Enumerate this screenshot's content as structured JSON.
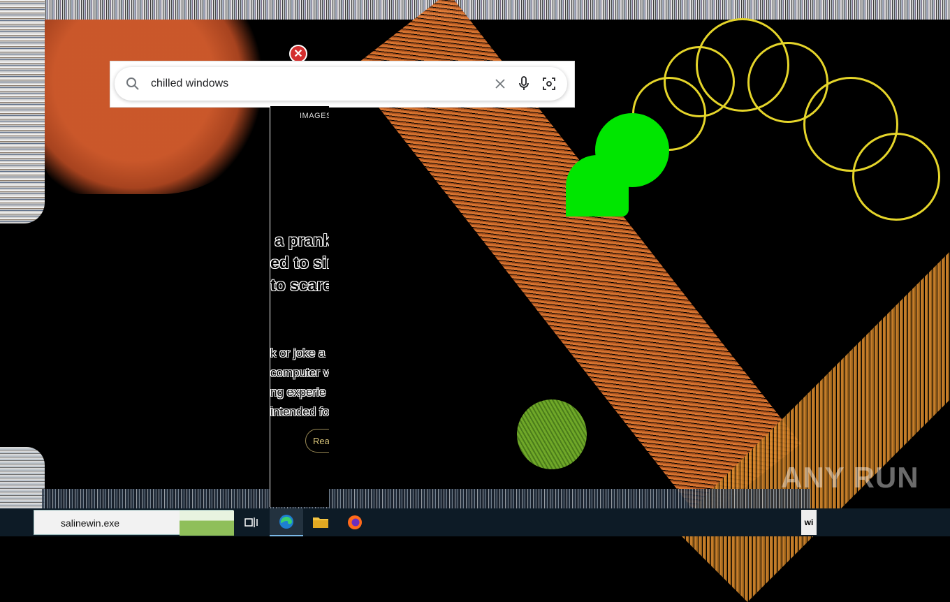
{
  "search": {
    "query": "chilled windows"
  },
  "panel": {
    "tab_label": "IMAGES",
    "headline": " a prank\ned to sim\nto scare",
    "body": "k or joke a\ncomputer v\nng experie\nintended fo",
    "read_more": "Rea"
  },
  "taskbar": {
    "search_text": "salinewin.exe",
    "tray_text": "wi",
    "apps": [
      "task-view",
      "edge",
      "file-explorer",
      "firefox"
    ]
  },
  "watermark": "ANY RUN",
  "colors": {
    "noise_green": "#00e600",
    "ring_yellow": "#e5d52a",
    "stripe_orange": "#e27a33"
  }
}
